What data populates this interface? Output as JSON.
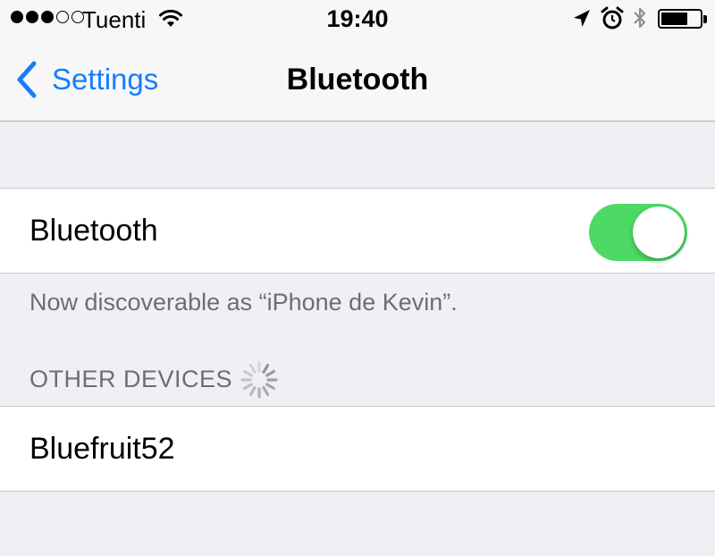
{
  "status_bar": {
    "carrier": "Tuenti",
    "time": "19:40",
    "signal_bars_filled": 3,
    "signal_bars_total": 5,
    "battery_level": 0.68,
    "icons": [
      "wifi-icon",
      "location-arrow-icon",
      "alarm-icon",
      "bluetooth-icon",
      "battery-icon"
    ]
  },
  "nav": {
    "back_label": "Settings",
    "title": "Bluetooth"
  },
  "bluetooth": {
    "label": "Bluetooth",
    "enabled": true,
    "toggle_color": "#4cd964",
    "discoverable_text": "Now discoverable as “iPhone de Kevin”."
  },
  "other_devices": {
    "header": "OTHER DEVICES",
    "items": [
      {
        "name": "Bluefruit52"
      }
    ]
  },
  "colors": {
    "accent": "#157efb",
    "background": "#efeff4",
    "secondary_text": "#6d6d72"
  }
}
